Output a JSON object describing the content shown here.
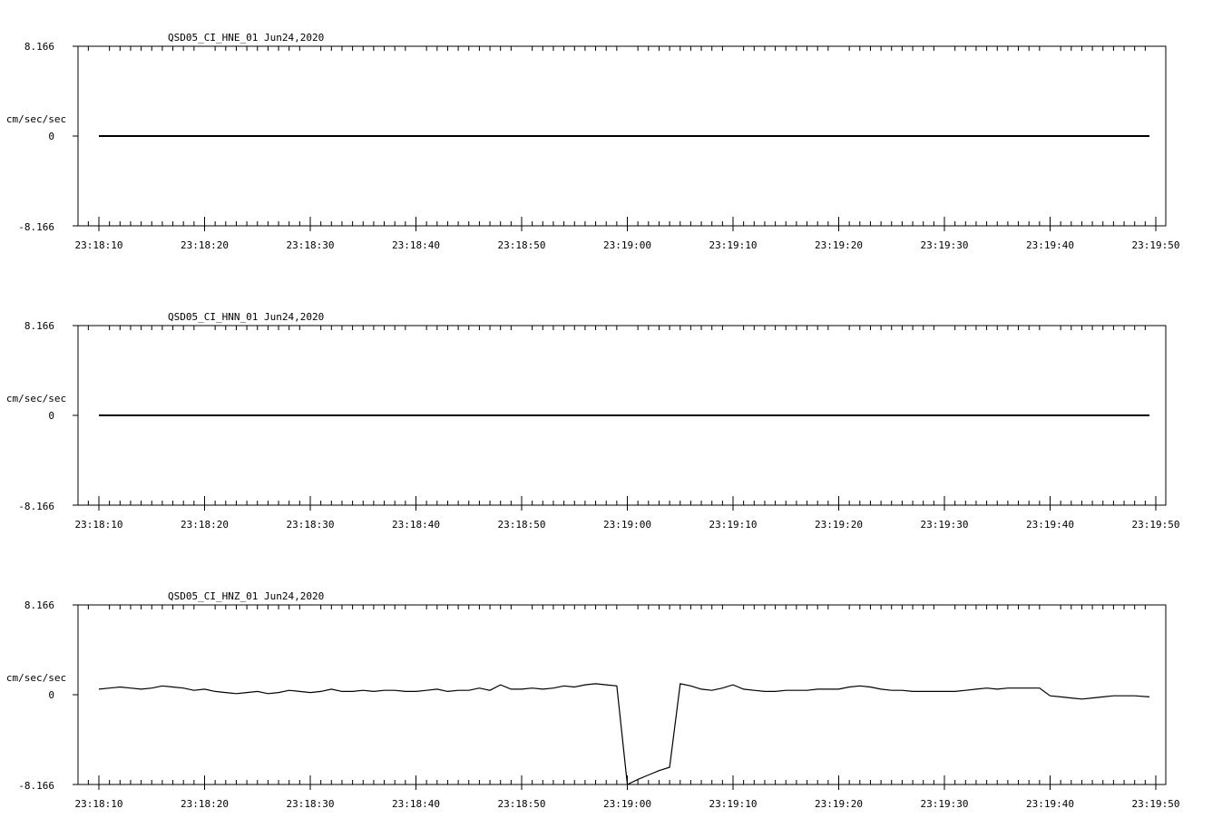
{
  "chart_data": [
    {
      "type": "line",
      "title": "QSD05_CI_HNE_01  Jun24,2020",
      "ylabel": "cm/sec/sec",
      "yticks": [
        "8.166",
        "0",
        "-8.166"
      ],
      "ylim": [
        -8.166,
        8.166
      ],
      "xlim": [
        0,
        100
      ],
      "xticks": [
        "23:18:10",
        "23:18:20",
        "23:18:30",
        "23:18:40",
        "23:18:50",
        "23:19:00",
        "23:19:10",
        "23:19:20",
        "23:19:30",
        "23:19:40",
        "23:19:50"
      ],
      "series": [
        {
          "x": [
            0,
            99.4
          ],
          "y": [
            0,
            0
          ]
        }
      ]
    },
    {
      "type": "line",
      "title": "QSD05_CI_HNN_01  Jun24,2020",
      "ylabel": "cm/sec/sec",
      "yticks": [
        "8.166",
        "0",
        "-8.166"
      ],
      "ylim": [
        -8.166,
        8.166
      ],
      "xlim": [
        0,
        100
      ],
      "xticks": [
        "23:18:10",
        "23:18:20",
        "23:18:30",
        "23:18:40",
        "23:18:50",
        "23:19:00",
        "23:19:10",
        "23:19:20",
        "23:19:30",
        "23:19:40",
        "23:19:50"
      ],
      "series": [
        {
          "x": [
            0,
            99.4
          ],
          "y": [
            0,
            0
          ]
        }
      ]
    },
    {
      "type": "line",
      "title": "QSD05_CI_HNZ_01  Jun24,2020",
      "ylabel": "cm/sec/sec",
      "yticks": [
        "8.166",
        "0",
        "-8.166"
      ],
      "ylim": [
        -8.166,
        8.166
      ],
      "xlim": [
        0,
        100
      ],
      "xticks": [
        "23:18:10",
        "23:18:20",
        "23:18:30",
        "23:18:40",
        "23:18:50",
        "23:19:00",
        "23:19:10",
        "23:19:20",
        "23:19:30",
        "23:19:40",
        "23:19:50"
      ],
      "series": [
        {
          "x": [
            0,
            1,
            2,
            3,
            4,
            5,
            6,
            7,
            8,
            9,
            10,
            11,
            12,
            13,
            14,
            15,
            16,
            17,
            18,
            19,
            20,
            21,
            22,
            23,
            24,
            25,
            26,
            27,
            28,
            29,
            30,
            31,
            32,
            33,
            34,
            35,
            36,
            37,
            38,
            39,
            40,
            41,
            42,
            43,
            44,
            45,
            46,
            47,
            48,
            49,
            50,
            51,
            52,
            53,
            54,
            55,
            56,
            57,
            58,
            59,
            60,
            61,
            62,
            63,
            64,
            65,
            66,
            67,
            68,
            69,
            70,
            71,
            72,
            73,
            74,
            75,
            76,
            77,
            78,
            79,
            80,
            81,
            82,
            83,
            84,
            85,
            86,
            87,
            88,
            89,
            90,
            91,
            92,
            93,
            94,
            95,
            96,
            97,
            98,
            99.4
          ],
          "y": [
            0.5,
            0.6,
            0.7,
            0.6,
            0.5,
            0.6,
            0.8,
            0.7,
            0.6,
            0.4,
            0.5,
            0.3,
            0.2,
            0.1,
            0.2,
            0.3,
            0.1,
            0.2,
            0.4,
            0.3,
            0.2,
            0.3,
            0.5,
            0.3,
            0.3,
            0.4,
            0.3,
            0.4,
            0.4,
            0.3,
            0.3,
            0.4,
            0.5,
            0.3,
            0.4,
            0.4,
            0.6,
            0.4,
            0.9,
            0.5,
            0.5,
            0.6,
            0.5,
            0.6,
            0.8,
            0.7,
            0.9,
            1.0,
            0.9,
            0.8,
            -8.2,
            -7.7,
            -7.3,
            -6.9,
            -6.6,
            1.0,
            0.8,
            0.5,
            0.4,
            0.6,
            0.9,
            0.5,
            0.4,
            0.3,
            0.3,
            0.4,
            0.4,
            0.4,
            0.5,
            0.5,
            0.5,
            0.7,
            0.8,
            0.7,
            0.5,
            0.4,
            0.4,
            0.3,
            0.3,
            0.3,
            0.3,
            0.3,
            0.4,
            0.5,
            0.6,
            0.5,
            0.6,
            0.6,
            0.6,
            0.6,
            -0.1,
            -0.2,
            -0.3,
            -0.4,
            -0.3,
            -0.2,
            -0.1,
            -0.1,
            -0.1,
            -0.2
          ]
        }
      ]
    }
  ]
}
